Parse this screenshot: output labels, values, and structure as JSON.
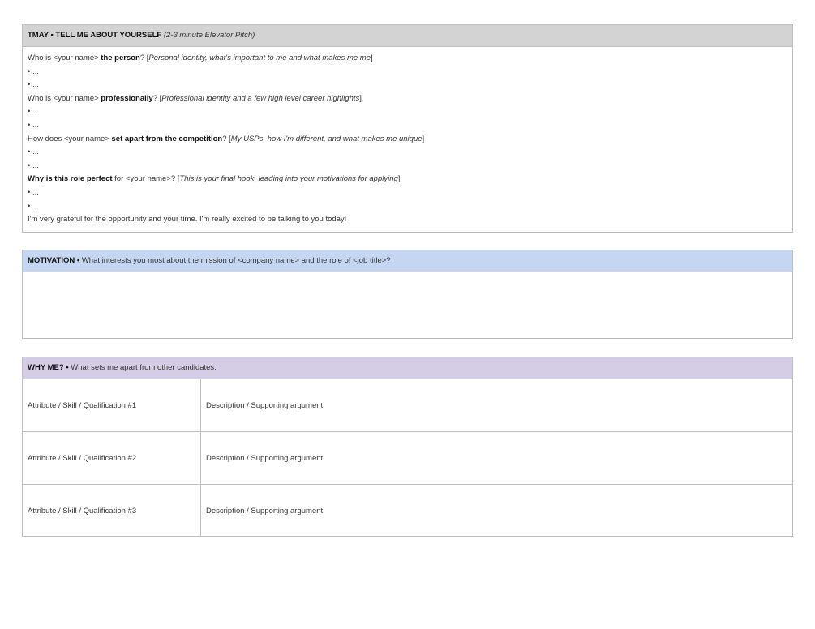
{
  "tmay": {
    "header_bold": "TMAY • TELL ME ABOUT YOURSELF",
    "header_italic": "(2-3 minute Elevator Pitch)",
    "q1": {
      "pre": "Who is <your name> ",
      "bold": "the person",
      "post": "? [",
      "italic": "Personal identity, what's important to me and what makes me me",
      "end": "]"
    },
    "q2": {
      "pre": "Who is <your name> ",
      "bold": "professionally",
      "post": "? [",
      "italic": "Professional identity and a few high level career highlights",
      "end": "]"
    },
    "q3": {
      "pre": "How does <your name> ",
      "bold": "set apart from the competition",
      "post": "? [",
      "italic": "My USPs, how I'm different, and what makes me unique",
      "end": "]"
    },
    "q4": {
      "bold": "Why is this role perfect",
      "post": " for <your name>? [",
      "italic": "This is your final hook, leading into your motivations for applying",
      "end": "]"
    },
    "bullet": "• ...",
    "closing": "I'm very grateful for the opportunity and your time. I'm really excited to be talking to you today!"
  },
  "motivation": {
    "header_bold": "MOTIVATION •",
    "header_text": " What interests you most about the mission of <company name> and the role of <job title>?"
  },
  "whyme": {
    "header_bold": "WHY ME? •",
    "header_text": " What sets me apart from other candidates:",
    "rows": [
      {
        "attribute": "Attribute / Skill / Qualification #1",
        "description": "Description / Supporting argument"
      },
      {
        "attribute": "Attribute / Skill / Qualification #2",
        "description": "Description / Supporting argument"
      },
      {
        "attribute": "Attribute / Skill / Qualification #3",
        "description": "Description / Supporting argument"
      }
    ]
  },
  "colors": {
    "tmay_header": "#d3d3d3",
    "motivation_header": "#c5d6f2",
    "whyme_header": "#d5cde6",
    "border": "#bdbdbd"
  }
}
